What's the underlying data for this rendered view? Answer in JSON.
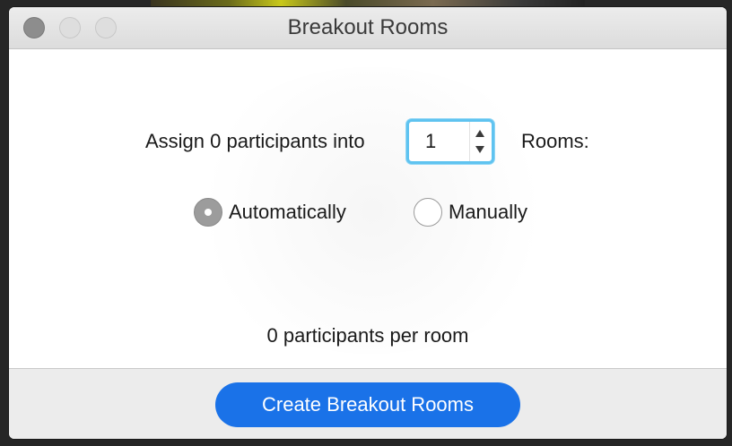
{
  "window": {
    "title": "Breakout Rooms"
  },
  "assign": {
    "prefix": "Assign 0 participants into",
    "room_count": "1",
    "suffix": "Rooms:"
  },
  "assignment_mode": {
    "options": [
      {
        "label": "Automatically",
        "selected": true
      },
      {
        "label": "Manually",
        "selected": false
      }
    ]
  },
  "summary": {
    "per_room": "0 participants per room"
  },
  "footer": {
    "create_label": "Create Breakout Rooms"
  },
  "colors": {
    "primary_button": "#1a72e8",
    "focus_ring": "#5fc3f0"
  }
}
